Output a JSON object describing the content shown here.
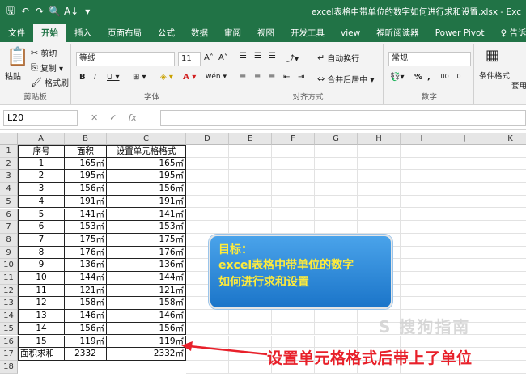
{
  "titlebar": {
    "qat": [
      "🖫",
      "↶",
      "↷",
      "🔍",
      "A↓",
      "▾"
    ],
    "doc_title": "excel表格中带单位的数字如何进行求和设置.xlsx - Exc"
  },
  "tabs": [
    "文件",
    "开始",
    "插入",
    "页面布局",
    "公式",
    "数据",
    "审阅",
    "视图",
    "开发工具",
    "view",
    "福昕阅读器",
    "Power Pivot",
    "♀ 告诉"
  ],
  "ribbon": {
    "clipboard": {
      "paste": "粘贴",
      "cut": "剪切",
      "copy": "复制 ▾",
      "format_painter": "格式刷",
      "label": "剪贴板"
    },
    "font": {
      "name": "等线",
      "size": "11",
      "grow": "A˄",
      "shrink": "A˅",
      "bold": "B",
      "italic": "I",
      "underline": "U ▾",
      "border": "⊞ ▾",
      "fill": "◈ ▾",
      "color": "A ▾",
      "wen": "wén ▾",
      "label": "字体"
    },
    "align": {
      "wrap": "自动换行",
      "merge": "合并后居中 ▾",
      "label": "对齐方式"
    },
    "number": {
      "format": "常规",
      "percent": "%",
      "comma": ",",
      "label": "数字"
    },
    "style": {
      "cond": "条件格式",
      "table": "套用表格格"
    }
  },
  "formula_bar": {
    "name_box": "L20",
    "cancel": "✕",
    "enter": "✓",
    "fx": "fx"
  },
  "columns": [
    "A",
    "B",
    "C",
    "D",
    "E",
    "F",
    "G",
    "H",
    "I",
    "J",
    "K"
  ],
  "table": {
    "header": [
      "序号",
      "面积",
      "设置单元格格式"
    ],
    "rows": [
      [
        "1",
        "165㎡",
        "165㎡"
      ],
      [
        "2",
        "195㎡",
        "195㎡"
      ],
      [
        "3",
        "156㎡",
        "156㎡"
      ],
      [
        "4",
        "191㎡",
        "191㎡"
      ],
      [
        "5",
        "141㎡",
        "141㎡"
      ],
      [
        "6",
        "153㎡",
        "153㎡"
      ],
      [
        "7",
        "175㎡",
        "175㎡"
      ],
      [
        "8",
        "176㎡",
        "176㎡"
      ],
      [
        "9",
        "136㎡",
        "136㎡"
      ],
      [
        "10",
        "144㎡",
        "144㎡"
      ],
      [
        "11",
        "121㎡",
        "121㎡"
      ],
      [
        "12",
        "158㎡",
        "158㎡"
      ],
      [
        "13",
        "146㎡",
        "146㎡"
      ],
      [
        "14",
        "156㎡",
        "156㎡"
      ],
      [
        "15",
        "119㎡",
        "119㎡"
      ]
    ],
    "total": [
      "面积求和",
      "2332",
      "2332㎡"
    ]
  },
  "row_numbers": [
    "1",
    "2",
    "3",
    "4",
    "5",
    "6",
    "7",
    "8",
    "9",
    "10",
    "11",
    "12",
    "13",
    "14",
    "15",
    "16",
    "17",
    "18"
  ],
  "callout": {
    "line1": "目标：",
    "line2": "excel表格中带单位的数字",
    "line3": "如何进行求和设置"
  },
  "annotation": "设置单元格格式后带上了单位",
  "watermark": "S 搜狗指南",
  "colors": {
    "excel_green": "#217346",
    "annotation_red": "#e8202a",
    "callout_blue": "#1b75c9",
    "callout_text": "#ffeb3b"
  }
}
